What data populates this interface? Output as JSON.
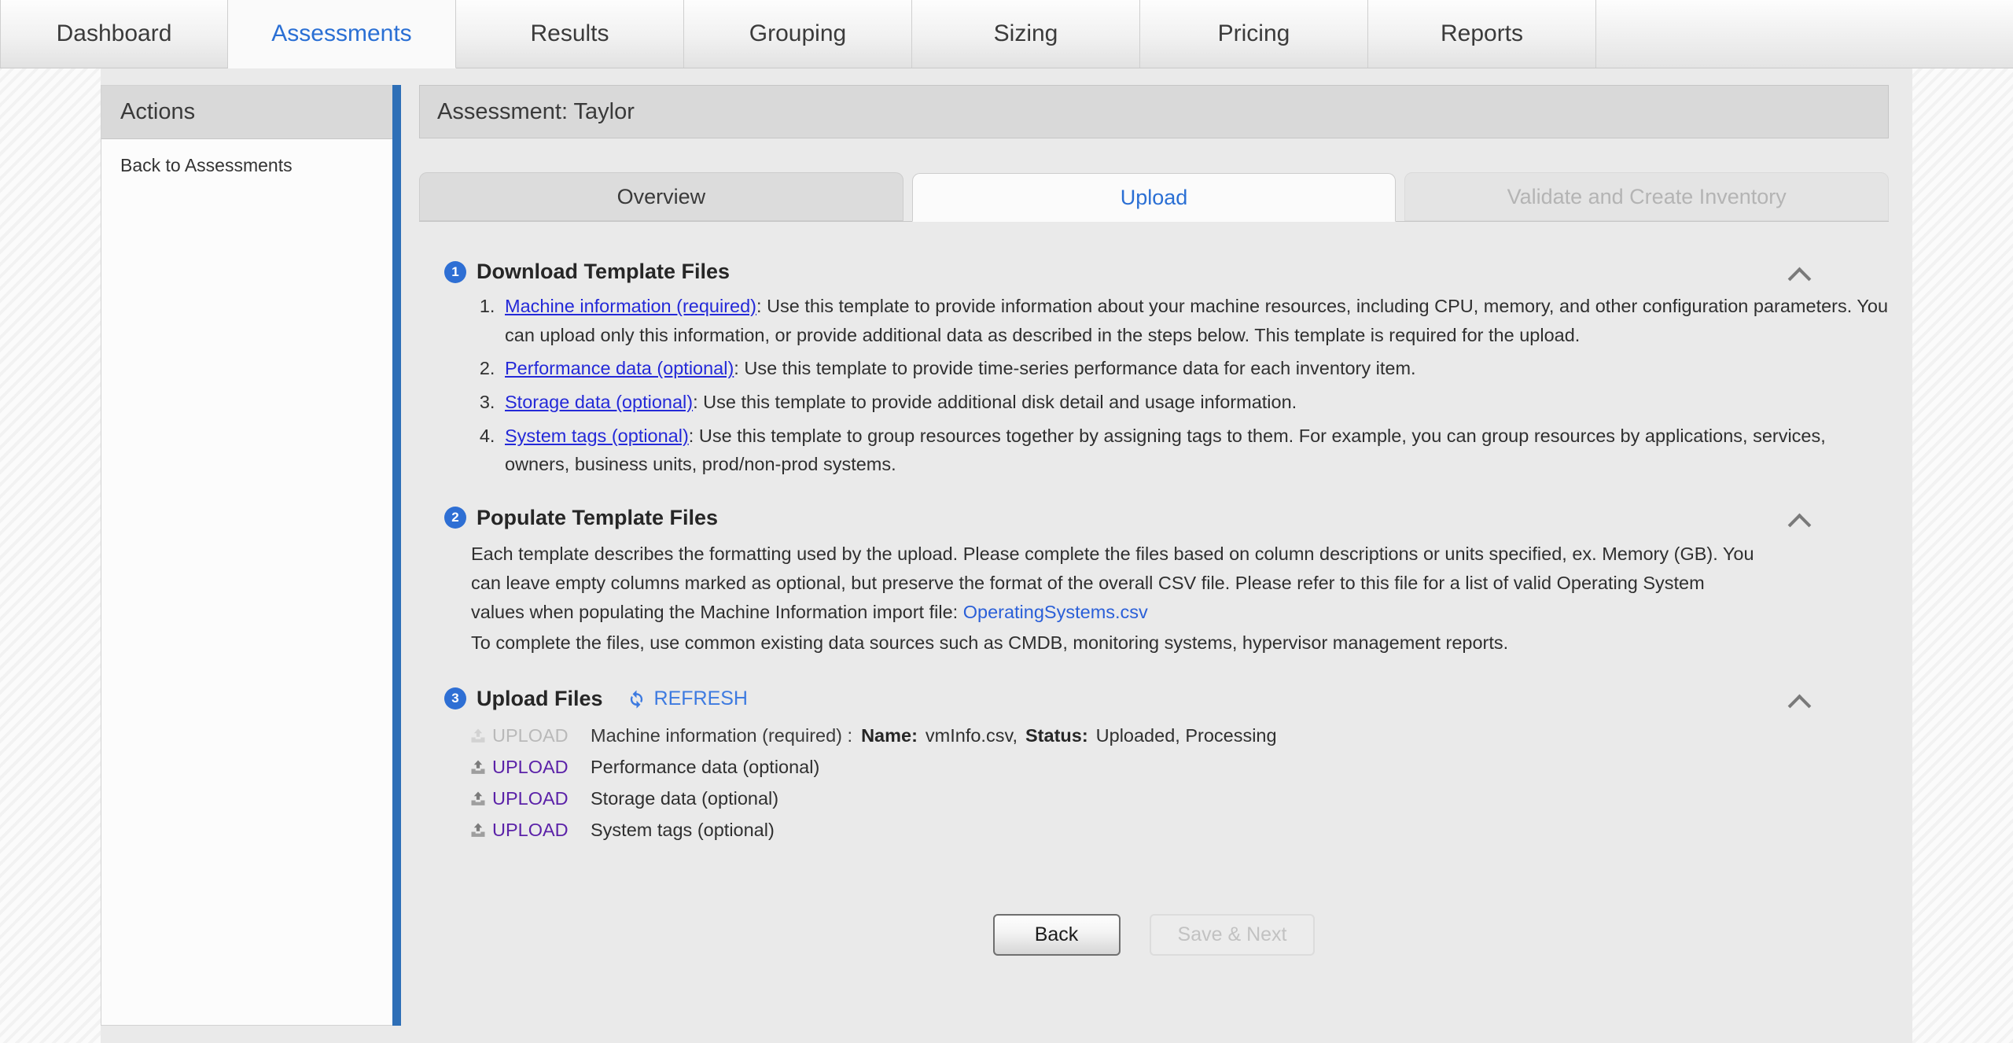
{
  "topnav": {
    "tabs": [
      {
        "label": "Dashboard",
        "active": false
      },
      {
        "label": "Assessments",
        "active": true
      },
      {
        "label": "Results",
        "active": false
      },
      {
        "label": "Grouping",
        "active": false
      },
      {
        "label": "Sizing",
        "active": false
      },
      {
        "label": "Pricing",
        "active": false
      },
      {
        "label": "Reports",
        "active": false
      }
    ]
  },
  "sidebar": {
    "header": "Actions",
    "links": [
      {
        "label": "Back to Assessments"
      }
    ]
  },
  "main": {
    "assessment_title": "Assessment: Taylor",
    "subtabs": [
      {
        "label": "Overview",
        "state": "inactive"
      },
      {
        "label": "Upload",
        "state": "active"
      },
      {
        "label": "Validate and Create Inventory",
        "state": "disabled"
      }
    ]
  },
  "step1": {
    "number": "1",
    "title": "Download Template Files",
    "items": [
      {
        "link": "Machine information (required)",
        "text": ": Use this template to provide information about your machine resources, including CPU, memory, and other configuration parameters. You can upload only this information, or provide additional data as described in the steps below. This template is required for the upload."
      },
      {
        "link": "Performance data (optional)",
        "text": ": Use this template to provide time-series performance data for each inventory item."
      },
      {
        "link": "Storage data (optional)",
        "text": ": Use this template to provide additional disk detail and usage information."
      },
      {
        "link": "System tags (optional)",
        "text": ": Use this template to group resources together by assigning tags to them. For example, you can group resources by applications, services, owners, business units, prod/non-prod systems."
      }
    ]
  },
  "step2": {
    "number": "2",
    "title": "Populate Template Files",
    "paragraph_before_link": "Each template describes the formatting used by the upload. Please complete the files based on column descriptions or units specified, ex. Memory (GB). You can leave empty columns marked as optional, but preserve the format of the overall CSV file. Please refer to this file for a list of valid Operating System values when populating the Machine Information import file: ",
    "link": "OperatingSystems.csv",
    "paragraph_after": "To complete the files, use common existing data sources such as CMDB, monitoring systems, hypervisor management reports."
  },
  "step3": {
    "number": "3",
    "title": "Upload Files",
    "refresh_label": "REFRESH",
    "rows": [
      {
        "upload_label": "UPLOAD",
        "disabled": true,
        "description": "Machine information (required) :",
        "name_key": "Name:",
        "name_value": "vmInfo.csv,",
        "status_key": "Status:",
        "status_value": "Uploaded, Processing"
      },
      {
        "upload_label": "UPLOAD",
        "disabled": false,
        "description": "Performance data (optional)"
      },
      {
        "upload_label": "UPLOAD",
        "disabled": false,
        "description": "Storage data (optional)"
      },
      {
        "upload_label": "UPLOAD",
        "disabled": false,
        "description": "System tags (optional)"
      }
    ]
  },
  "footer": {
    "back_label": "Back",
    "save_next_label": "Save & Next"
  },
  "colors": {
    "accent_blue": "#2e6fb7",
    "link_blue": "#2429d8",
    "tab_blue": "#2a6fd4",
    "upload_purple": "#5b22a8",
    "badge_blue": "#2e6fd4"
  }
}
